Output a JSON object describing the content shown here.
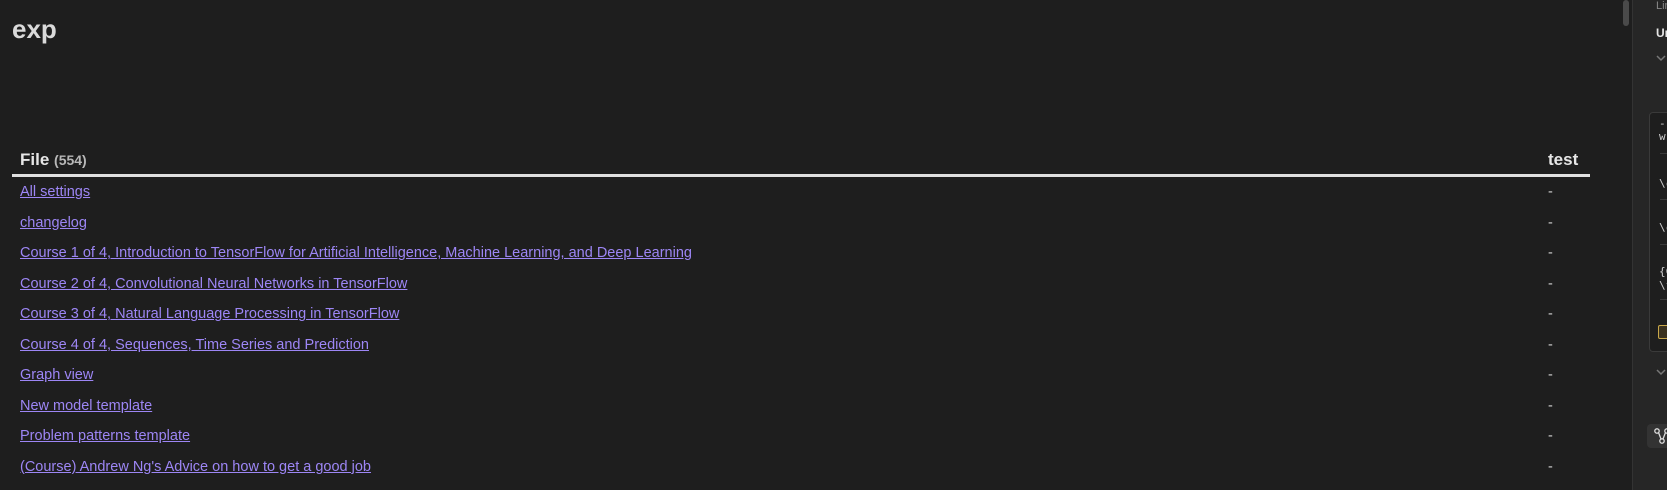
{
  "page": {
    "title": "exp"
  },
  "table": {
    "header_file_label": "File",
    "header_file_count": "(554)",
    "header_test_label": "test",
    "rows": [
      {
        "file": "All settings",
        "test": "-"
      },
      {
        "file": "changelog",
        "test": "-"
      },
      {
        "file": "Course 1 of 4, Introduction to TensorFlow for Artificial Intelligence, Machine Learning, and Deep Learning",
        "test": "-"
      },
      {
        "file": "Course 2 of 4, Convolutional Neural Networks in TensorFlow",
        "test": "-"
      },
      {
        "file": "Course 3 of 4, Natural Language Processing in TensorFlow",
        "test": "-"
      },
      {
        "file": "Course 4 of 4, Sequences, Time Series and Prediction",
        "test": "-"
      },
      {
        "file": "Graph view",
        "test": "-"
      },
      {
        "file": "New model template",
        "test": "-"
      },
      {
        "file": "Problem patterns template",
        "test": "-"
      },
      {
        "file": "(Course) Andrew Ng's Advice on how to get a good job",
        "test": "-"
      }
    ]
  },
  "sidebar": {
    "label": "Lin",
    "heading": "Un",
    "box_lines": [
      "-",
      "w",
      "\\c",
      "\\c",
      "{C",
      "\\f"
    ]
  },
  "colors": {
    "background": "#1e1e1e",
    "link": "#9d86f5",
    "sidebar_bg": "#262626"
  },
  "icons": [
    "chevron-down-icon",
    "graph-icon",
    "tag-icon"
  ]
}
